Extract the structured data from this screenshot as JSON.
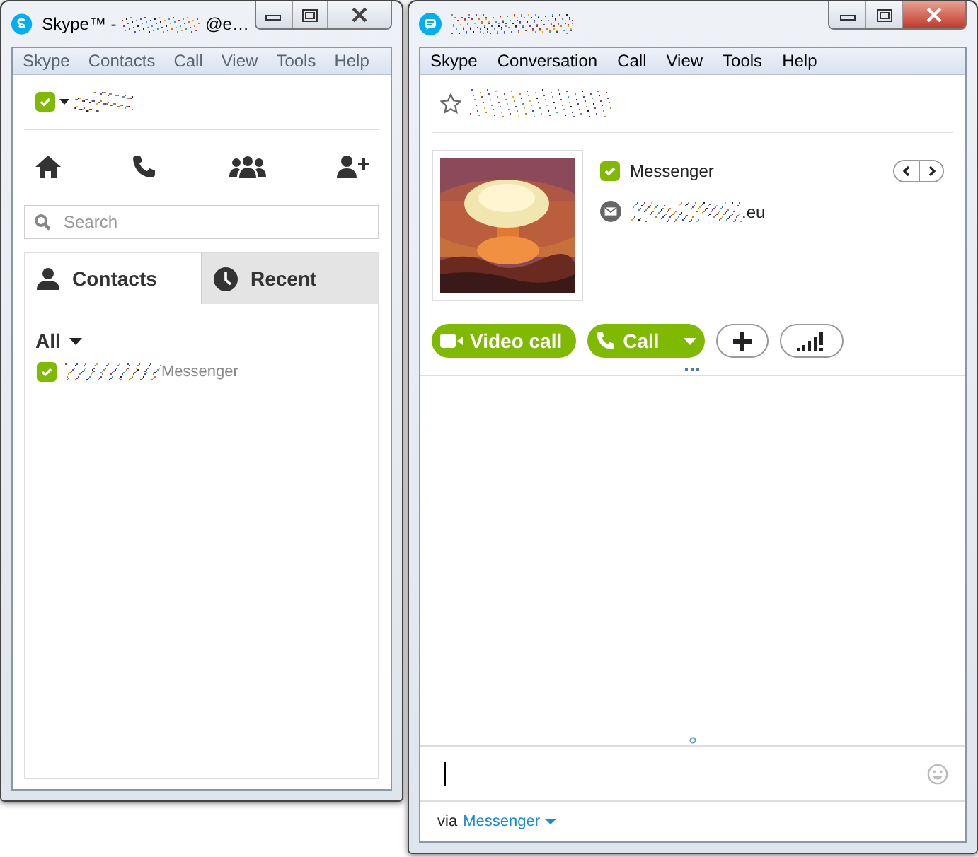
{
  "left_window": {
    "active": false,
    "title_prefix": "Skype™ -",
    "title_suffix": "@e…",
    "menu": [
      "Skype",
      "Contacts",
      "Call",
      "View",
      "Tools",
      "Help"
    ],
    "nav_icons": [
      {
        "kind": "home"
      },
      {
        "kind": "call"
      },
      {
        "kind": "group"
      },
      {
        "kind": "add-contact"
      }
    ],
    "search": {
      "placeholder": "Search"
    },
    "tabs": [
      {
        "label": "Contacts",
        "kind": "person",
        "selected": true
      },
      {
        "label": "Recent",
        "kind": "clock",
        "selected": false
      }
    ],
    "filter": "All",
    "contacts": [
      {
        "source": "Messenger"
      }
    ]
  },
  "right_window": {
    "active": true,
    "menu": [
      "Skype",
      "Conversation",
      "Call",
      "View",
      "Tools",
      "Help"
    ],
    "favorite": false,
    "service": "Messenger",
    "email_suffix": ".eu",
    "buttons": [
      {
        "kind": "video",
        "label": "Video call"
      },
      {
        "kind": "call",
        "label": "Call"
      },
      {
        "kind": "add"
      },
      {
        "kind": "signal"
      }
    ],
    "via_label": "via",
    "via_service": "Messenger"
  }
}
